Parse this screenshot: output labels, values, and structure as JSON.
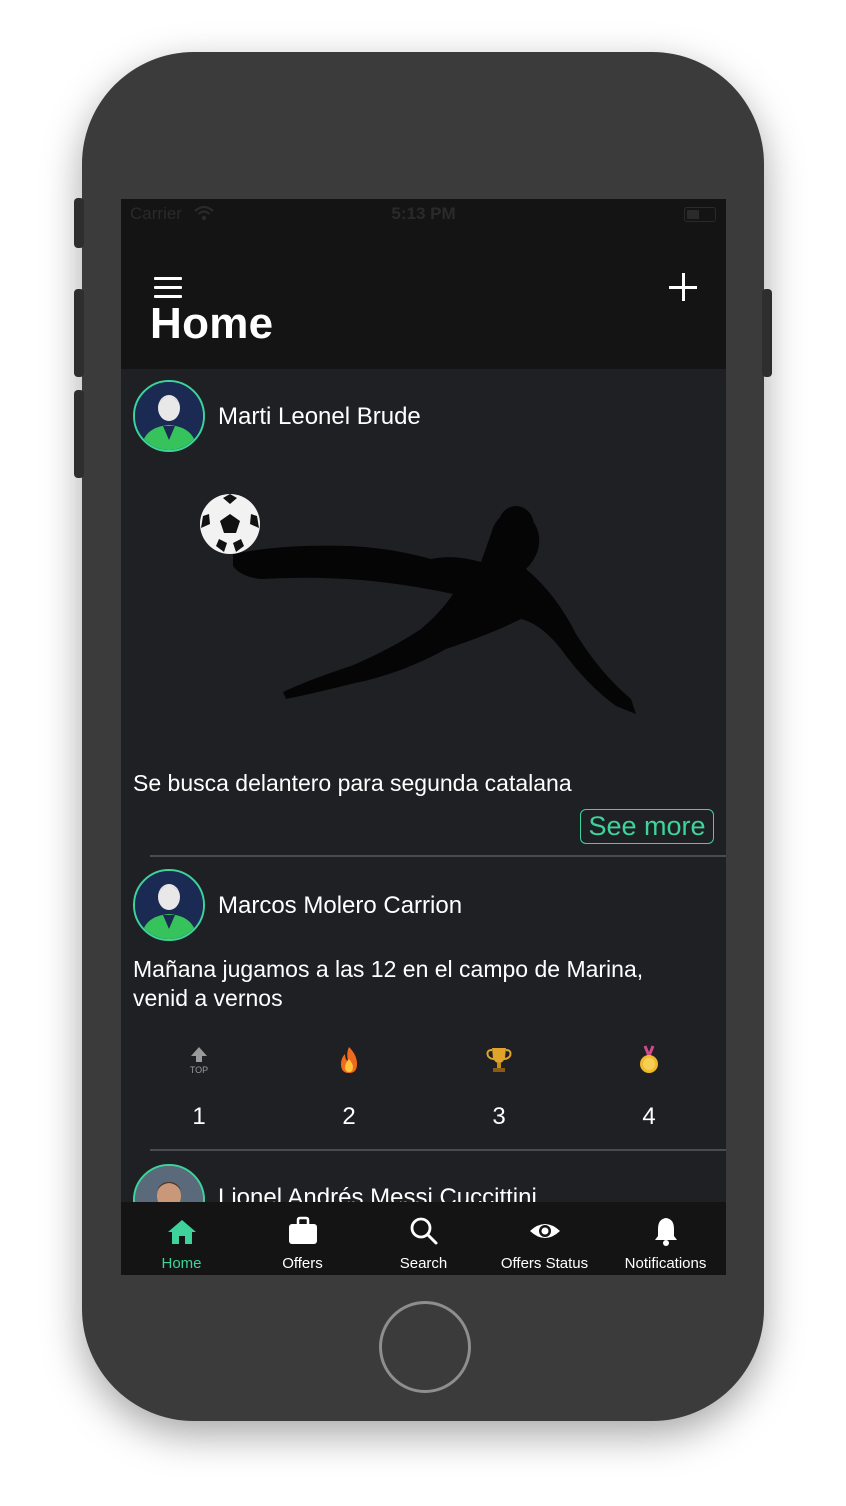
{
  "colors": {
    "accent": "#3dd39a",
    "background": "#1f2024",
    "bar": "#141414"
  },
  "status_bar": {
    "carrier": "Carrier",
    "time": "5:13 PM"
  },
  "header": {
    "title": "Home",
    "menu_icon": "hamburger-menu-icon",
    "add_icon": "plus-icon"
  },
  "posts": [
    {
      "author": "Marti Leonel Brude",
      "text": "Se busca delantero para segunda catalana",
      "see_more": "See more"
    },
    {
      "author": "Marcos Molero Carrion",
      "text": "Mañana jugamos a las 12 en el campo de Marina, venid a vernos",
      "stats": [
        {
          "icon": "top-arrow-icon",
          "value": "1"
        },
        {
          "icon": "fire-icon",
          "value": "2"
        },
        {
          "icon": "trophy-icon",
          "value": "3"
        },
        {
          "icon": "medal-icon",
          "value": "4"
        }
      ]
    },
    {
      "author": "Lionel Andrés Messi Cuccittini"
    }
  ],
  "tabs": [
    {
      "label": "Home",
      "icon": "home-icon",
      "active": true
    },
    {
      "label": "Offers",
      "icon": "briefcase-icon"
    },
    {
      "label": "Search",
      "icon": "search-icon"
    },
    {
      "label": "Offers Status",
      "icon": "eye-icon"
    },
    {
      "label": "Notifications",
      "icon": "bell-icon"
    }
  ]
}
